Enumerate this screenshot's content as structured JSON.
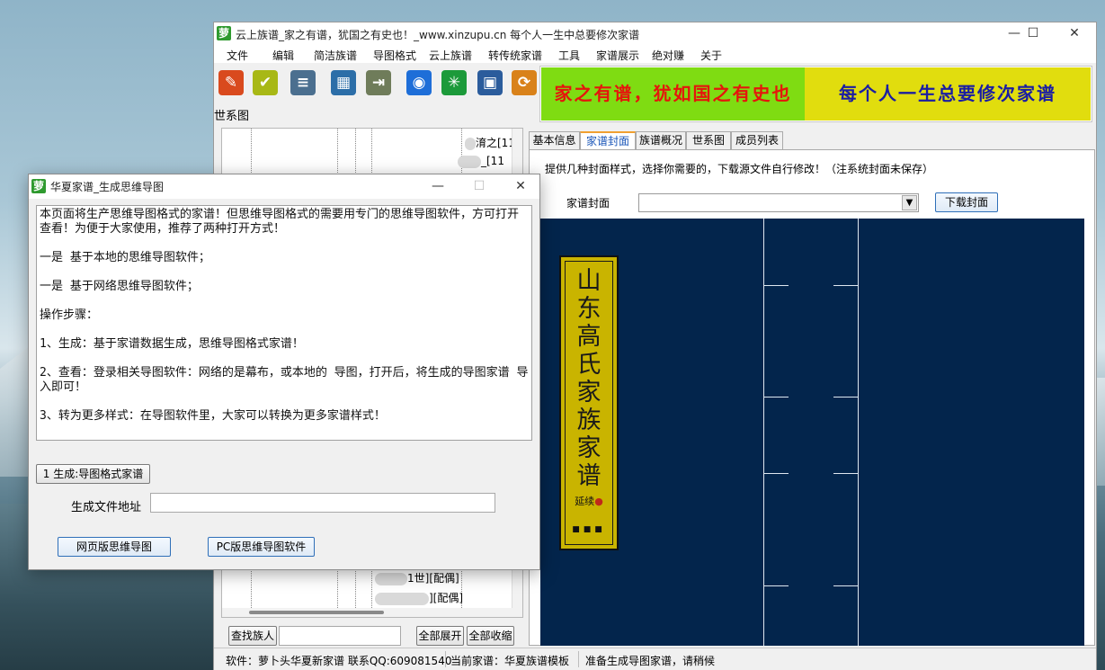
{
  "main_window": {
    "app_icon": "萝",
    "title": "云上族谱_家之有谱，犹国之有史也！_www.xinzupu.cn 每个人一生中总要修次家谱",
    "controls": {
      "minimize": "—",
      "maximize": "☐",
      "close": "✕"
    }
  },
  "menu": [
    "文件",
    "编辑",
    "简洁族谱",
    "导图格式",
    "云上族谱",
    "转传统家谱",
    "工具",
    "家谱展示",
    "绝对赚",
    "关于"
  ],
  "toolbar": {
    "icons": [
      {
        "name": "pen-icon",
        "glyph": "✎",
        "color": "#d94a1e"
      },
      {
        "name": "edit-icon",
        "glyph": "✔",
        "color": "#a8b816"
      },
      {
        "name": "book-icon",
        "glyph": "≡",
        "color": "#4b6f8f"
      },
      {
        "name": "calculator-icon",
        "glyph": "▦",
        "color": "#2c6ea8"
      },
      {
        "name": "door-icon",
        "glyph": "⇥",
        "color": "#6f7c5a"
      },
      {
        "name": "globe-icon",
        "glyph": "◉",
        "color": "#1e6ed8"
      },
      {
        "name": "emblem-icon",
        "glyph": "✳",
        "color": "#1c9a3a"
      },
      {
        "name": "floppy-icon",
        "glyph": "▣",
        "color": "#2b5c9c"
      },
      {
        "name": "refresh-icon",
        "glyph": "⟳",
        "color": "#d9821a"
      }
    ]
  },
  "banner": {
    "left_text": "家之有谱，犹如国之有史也",
    "right_text": "每个人一生总要修次家谱"
  },
  "tree": {
    "label": "世系图",
    "nodes": [
      {
        "text": "淯之[11"
      },
      {
        "text": "_[11"
      },
      {
        "text": "1世][配偶]"
      },
      {
        "text": "][配偶]"
      }
    ],
    "search_button": "查找族人",
    "search_value": "",
    "expand_button": "全部展开",
    "collapse_button": "全部收缩"
  },
  "tabs": [
    "基本信息",
    "家谱封面",
    "族谱概况",
    "世系图",
    "成员列表"
  ],
  "cover_panel": {
    "description": "提供几种封面样式，选择你需要的，下载源文件自行修改！（注系统封面未保存）",
    "select_label": "家谱封面",
    "select_value": "",
    "download_button": "下载封面",
    "cover_title": "山东高氏家族家谱",
    "cover_subtitle": "延续",
    "cover_dots": "■■■",
    "cover_background": "#03254c",
    "cover_title_color": "#c9b400"
  },
  "status": {
    "software": "软件：萝卜头华夏新家谱 联系QQ:609081540",
    "current": "当前家谱：华夏族谱模板",
    "message": "准备生成导图家谱，请稍候"
  },
  "dialog": {
    "icon": "萝",
    "title": "华夏家谱_生成思维导图",
    "controls": {
      "minimize": "—",
      "maximize": "☐",
      "close": "✕"
    },
    "paragraphs": [
      "本页面将生产思维导图格式的家谱！但思维导图格式的需要用专门的思维导图软件，方可打开查看！为便于大家使用，推荐了两种打开方式！",
      "一是  基于本地的思维导图软件；",
      "一是 基于网络思维导图软件；",
      "操作步骤：",
      "1、生成：基于家谱数据生成，思维导图格式家谱！",
      "2、查看：登录相关导图软件：网络的是幕布，或本地的 导图，打开后，将生成的导图家谱 导入即可！",
      "3、转为更多样式：在导图软件里，大家可以转换为更多家谱样式！"
    ],
    "generate_button": "1 生成:导图格式家谱",
    "file_label": "生成文件地址",
    "file_value": "",
    "web_button": "网页版思维导图",
    "pc_button": "PC版思维导图软件"
  }
}
